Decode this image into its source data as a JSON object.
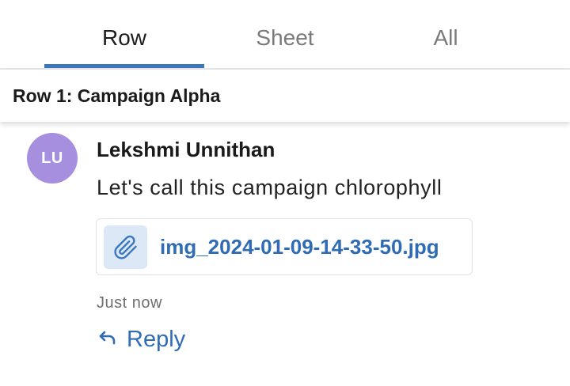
{
  "tabs": [
    {
      "label": "Row",
      "active": true
    },
    {
      "label": "Sheet",
      "active": false
    },
    {
      "label": "All",
      "active": false
    }
  ],
  "row_header": {
    "title": "Row 1: Campaign Alpha"
  },
  "comment": {
    "avatar_initials": "LU",
    "avatar_color": "#a78fdf",
    "author": "Lekshmi Unnithan",
    "message": "Let's call this campaign chlorophyll",
    "attachment": {
      "icon": "paperclip-icon",
      "file_name": "img_2024-01-09-14-33-50.jpg"
    },
    "timestamp": "Just now",
    "reply": {
      "icon": "reply-arrow-icon",
      "label": "Reply"
    }
  },
  "colors": {
    "accent": "#3b77be",
    "link": "#2f6cb5"
  }
}
